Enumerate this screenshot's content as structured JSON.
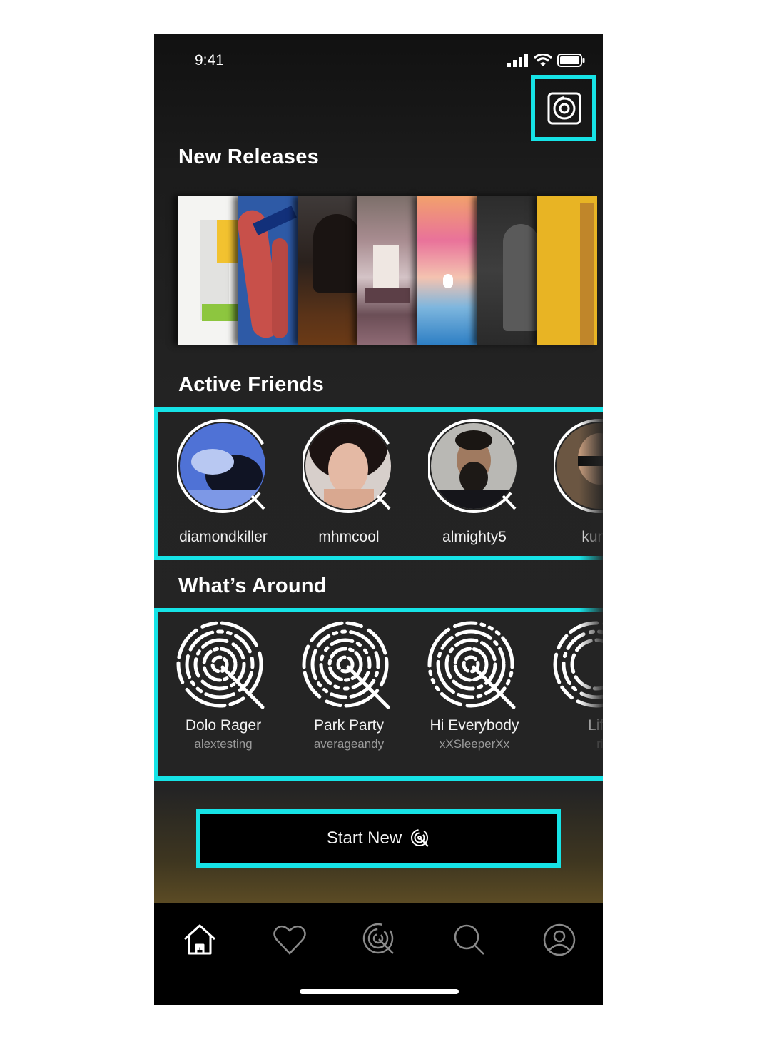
{
  "status_bar": {
    "time": "9:41"
  },
  "header": {
    "profile_icon": "vinyl-square-icon"
  },
  "new_releases": {
    "title": "New Releases",
    "albums": [
      "album-1",
      "album-2",
      "album-3",
      "album-4",
      "album-5",
      "album-6",
      "album-7"
    ]
  },
  "active_friends": {
    "title": "Active Friends",
    "friends": [
      {
        "name": "diamondkiller"
      },
      {
        "name": "mhmcool"
      },
      {
        "name": "almighty5"
      },
      {
        "name": "kungf"
      }
    ]
  },
  "whats_around": {
    "title": "What’s Around",
    "items": [
      {
        "title": "Dolo Rager",
        "user": "alextesting"
      },
      {
        "title": "Park Party",
        "user": "averageandy"
      },
      {
        "title": "Hi Everybody",
        "user": "xXSleeperXx"
      },
      {
        "title": "Life",
        "user": "ri"
      }
    ]
  },
  "start_button": {
    "label": "Start New"
  },
  "tab_bar": {
    "tabs": [
      "home-icon",
      "heart-icon",
      "broadcast-icon",
      "search-icon",
      "profile-icon"
    ]
  },
  "colors": {
    "highlight": "#16e3e6",
    "background": "#232323"
  }
}
